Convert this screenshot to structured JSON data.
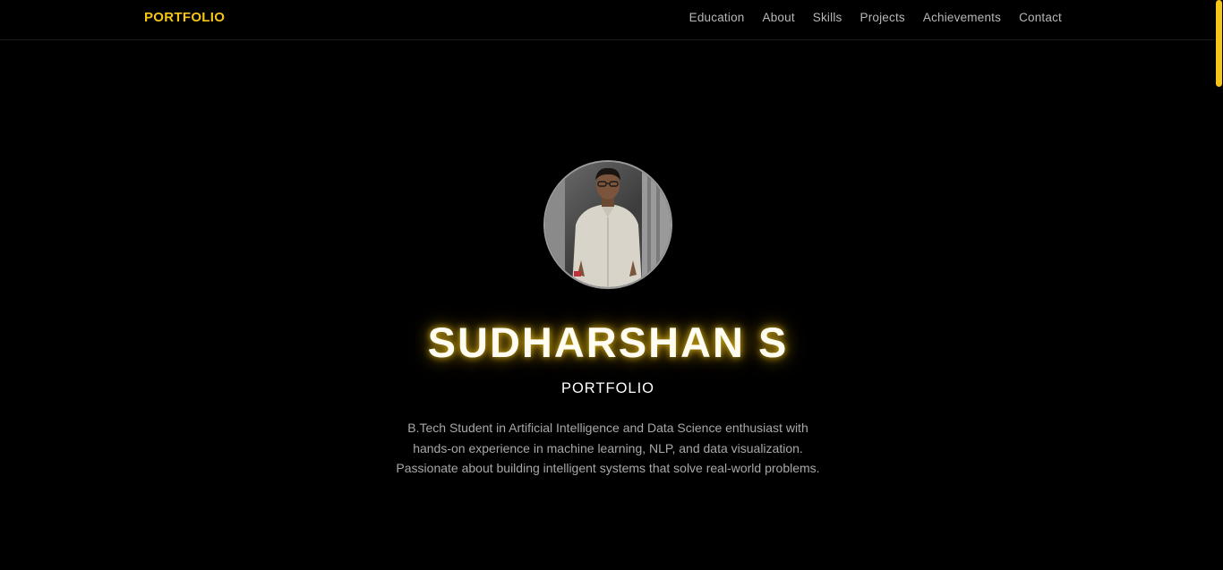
{
  "navbar": {
    "brand": "PORTFOLIO",
    "links": [
      "Education",
      "About",
      "Skills",
      "Projects",
      "Achievements",
      "Contact"
    ]
  },
  "hero": {
    "name": "SUDHARSHAN S",
    "subtitle": "PORTFOLIO",
    "bio": "B.Tech Student in Artificial Intelligence and Data Science enthusiast with hands-on experience in machine learning, NLP, and data visualization. Passionate about building intelligent systems that solve real-world problems."
  },
  "colors": {
    "background": "#000000",
    "accent": "#f5c518",
    "nav_text": "#b8b8b8",
    "bio_text": "#a8a8a8"
  }
}
